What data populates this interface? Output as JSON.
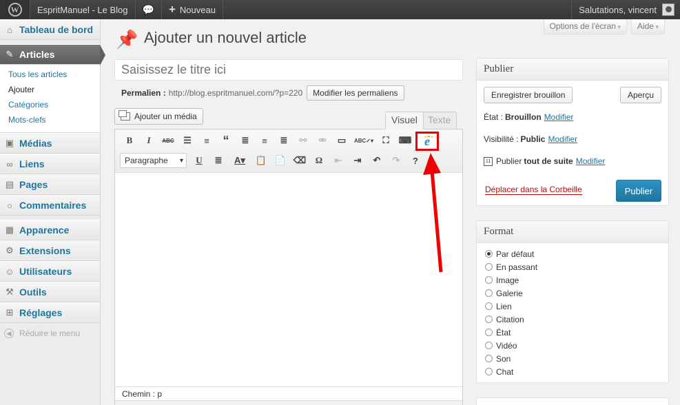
{
  "adminbar": {
    "site_name": "EspritManuel - Le Blog",
    "new_label": "Nouveau",
    "greeting": "Salutations, vincent"
  },
  "sidebar": {
    "items": [
      {
        "label": "Tableau de bord",
        "icon": "dashboard-icon"
      },
      {
        "label": "Articles",
        "icon": "pin-icon"
      },
      {
        "label": "Médias",
        "icon": "media-icon"
      },
      {
        "label": "Liens",
        "icon": "link-icon"
      },
      {
        "label": "Pages",
        "icon": "pages-icon"
      },
      {
        "label": "Commentaires",
        "icon": "comments-icon"
      },
      {
        "label": "Apparence",
        "icon": "appearance-icon"
      },
      {
        "label": "Extensions",
        "icon": "plugins-icon"
      },
      {
        "label": "Utilisateurs",
        "icon": "users-icon"
      },
      {
        "label": "Outils",
        "icon": "tools-icon"
      },
      {
        "label": "Réglages",
        "icon": "settings-icon"
      }
    ],
    "submenu": [
      "Tous les articles",
      "Ajouter",
      "Catégories",
      "Mots-clefs"
    ],
    "collapse_label": "Réduire le menu"
  },
  "screen_meta": {
    "options_label": "Options de l'écran",
    "help_label": "Aide"
  },
  "page_title": "Ajouter un nouvel article",
  "title_placeholder": "Saisissez le titre ici",
  "permalink": {
    "label": "Permalien :",
    "url": "http://blog.espritmanuel.com/?p=220",
    "button_label": "Modifier les permaliens"
  },
  "editor": {
    "add_media_label": "Ajouter un média",
    "tab_visual": "Visuel",
    "tab_text": "Texte",
    "format_select": "Paragraphe",
    "path_label": "Chemin : p"
  },
  "publish_box": {
    "title": "Publier",
    "save_draft_label": "Enregistrer brouillon",
    "preview_label": "Aperçu",
    "status_label": "État :",
    "status_value": "Brouillon",
    "visibility_label": "Visibilité :",
    "visibility_value": "Public",
    "publish_label": "Publier",
    "publish_when": "tout de suite",
    "edit_link": "Modifier",
    "trash_label": "Déplacer dans la Corbeille",
    "publish_button": "Publier"
  },
  "format_box": {
    "title": "Format",
    "options": [
      "Par défaut",
      "En passant",
      "Image",
      "Galerie",
      "Lien",
      "Citation",
      "État",
      "Vidéo",
      "Son",
      "Chat"
    ],
    "selected": "Par défaut"
  },
  "colors": {
    "accent": "#21759b",
    "highlight": "#ee0000",
    "trash": "#bc0b0b"
  }
}
